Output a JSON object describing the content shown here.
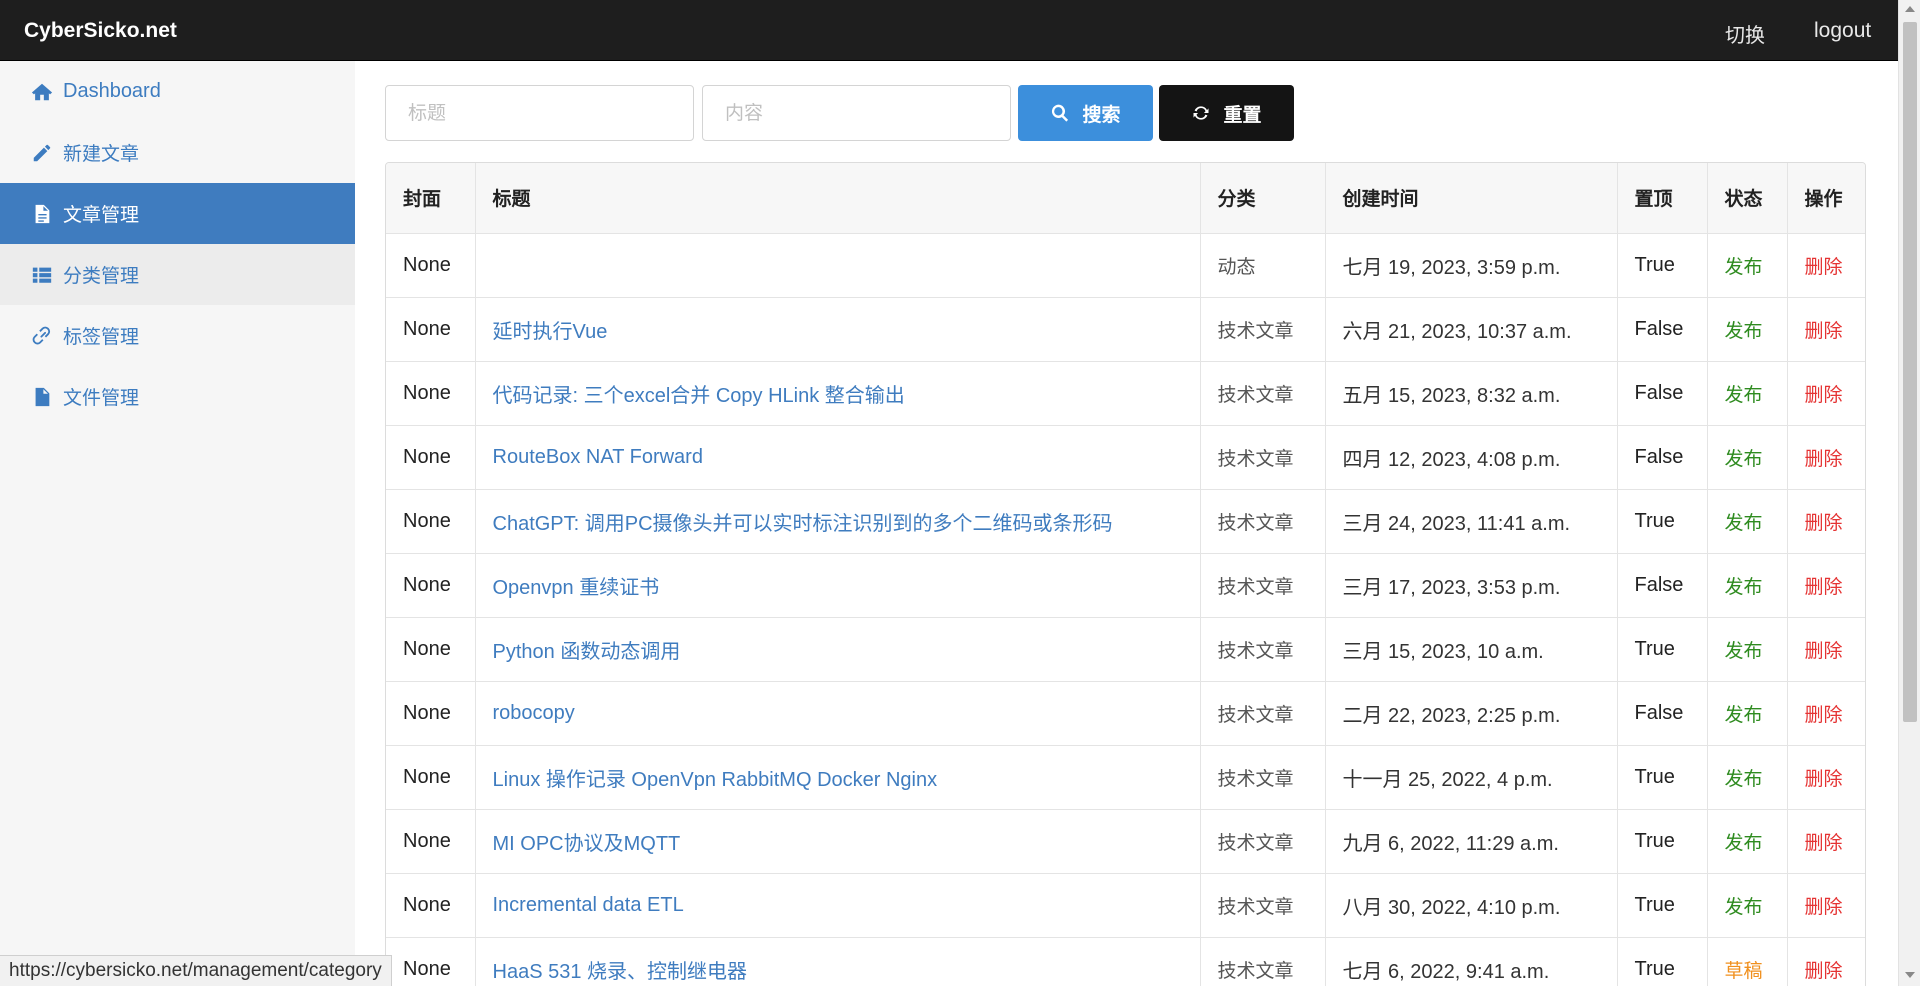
{
  "navbar": {
    "brand": "CyberSicko.net",
    "switch_label": "切换",
    "logout_label": "logout"
  },
  "sidebar": {
    "items": [
      {
        "label": "Dashboard",
        "icon": "home-icon"
      },
      {
        "label": "新建文章",
        "icon": "pencil-icon"
      },
      {
        "label": "文章管理",
        "icon": "file-text-icon"
      },
      {
        "label": "分类管理",
        "icon": "list-icon"
      },
      {
        "label": "标签管理",
        "icon": "link-icon"
      },
      {
        "label": "文件管理",
        "icon": "file-icon"
      }
    ],
    "active_index": 2,
    "hover_index": 3
  },
  "search": {
    "title_placeholder": "标题",
    "content_placeholder": "内容",
    "search_label": "搜索",
    "reset_label": "重置"
  },
  "table": {
    "headers": [
      "封面",
      "标题",
      "分类",
      "创建时间",
      "置顶",
      "状态",
      "操作"
    ],
    "rows": [
      {
        "cover": "None",
        "title": "",
        "category": "动态",
        "created": "七月 19, 2023, 3:59 p.m.",
        "pinned": "True",
        "status": "发布",
        "action": "删除"
      },
      {
        "cover": "None",
        "title": "延时执行Vue",
        "category": "技术文章",
        "created": "六月 21, 2023, 10:37 a.m.",
        "pinned": "False",
        "status": "发布",
        "action": "删除"
      },
      {
        "cover": "None",
        "title": "代码记录: 三个excel合并 Copy HLink 整合输出",
        "category": "技术文章",
        "created": "五月 15, 2023, 8:32 a.m.",
        "pinned": "False",
        "status": "发布",
        "action": "删除"
      },
      {
        "cover": "None",
        "title": "RouteBox NAT Forward",
        "category": "技术文章",
        "created": "四月 12, 2023, 4:08 p.m.",
        "pinned": "False",
        "status": "发布",
        "action": "删除"
      },
      {
        "cover": "None",
        "title": "ChatGPT: 调用PC摄像头并可以实时标注识别到的多个二维码或条形码",
        "category": "技术文章",
        "created": "三月 24, 2023, 11:41 a.m.",
        "pinned": "True",
        "status": "发布",
        "action": "删除"
      },
      {
        "cover": "None",
        "title": "Openvpn 重续证书",
        "category": "技术文章",
        "created": "三月 17, 2023, 3:53 p.m.",
        "pinned": "False",
        "status": "发布",
        "action": "删除"
      },
      {
        "cover": "None",
        "title": "Python 函数动态调用",
        "category": "技术文章",
        "created": "三月 15, 2023, 10 a.m.",
        "pinned": "True",
        "status": "发布",
        "action": "删除"
      },
      {
        "cover": "None",
        "title": "robocopy",
        "category": "技术文章",
        "created": "二月 22, 2023, 2:25 p.m.",
        "pinned": "False",
        "status": "发布",
        "action": "删除"
      },
      {
        "cover": "None",
        "title": "Linux 操作记录 OpenVpn RabbitMQ Docker Nginx",
        "category": "技术文章",
        "created": "十一月 25, 2022, 4 p.m.",
        "pinned": "True",
        "status": "发布",
        "action": "删除"
      },
      {
        "cover": "None",
        "title": "MI OPC协议及MQTT",
        "category": "技术文章",
        "created": "九月 6, 2022, 11:29 a.m.",
        "pinned": "True",
        "status": "发布",
        "action": "删除"
      },
      {
        "cover": "None",
        "title": "Incremental data ETL",
        "category": "技术文章",
        "created": "八月 30, 2022, 4:10 p.m.",
        "pinned": "True",
        "status": "发布",
        "action": "删除"
      },
      {
        "cover": "None",
        "title": "HaaS 531 烧录、控制继电器",
        "category": "技术文章",
        "created": "七月 6, 2022, 9:41 a.m.",
        "pinned": "True",
        "status": "草稿",
        "action": "删除"
      }
    ]
  },
  "colors": {
    "published": "#2e8b1f",
    "draft": "#f0901e",
    "delete": "#e53333",
    "link": "#3f7cbf",
    "navbar": "#1e1e1e"
  },
  "status_bar": {
    "url": "https://cybersicko.net/management/category"
  }
}
